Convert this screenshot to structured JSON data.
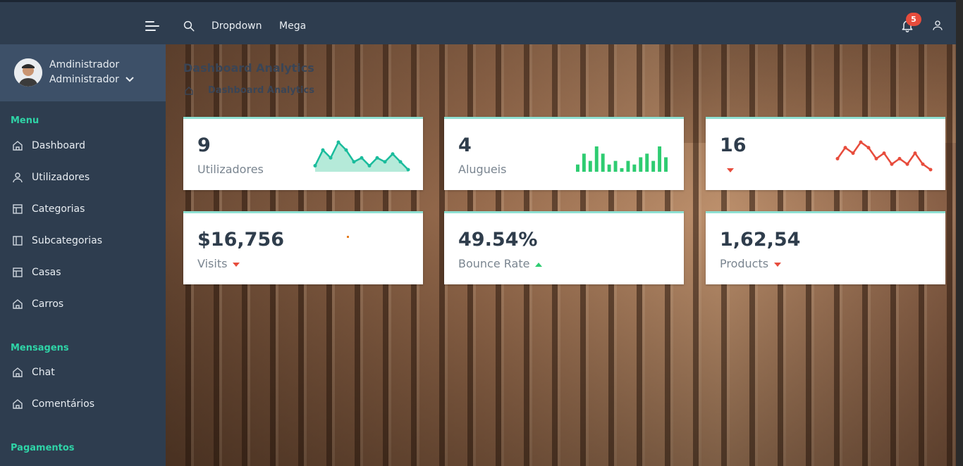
{
  "header": {
    "nav_links": [
      "Dropdown",
      "Mega"
    ],
    "notification_count": "5"
  },
  "sidebar": {
    "profile": {
      "name": "Amdinistrador",
      "role": "Administrador"
    },
    "sections": [
      {
        "title": "Menu",
        "items": [
          {
            "label": "Dashboard",
            "icon": "home-icon"
          },
          {
            "label": "Utilizadores",
            "icon": "user-icon"
          },
          {
            "label": "Categorias",
            "icon": "table-icon"
          },
          {
            "label": "Subcategorias",
            "icon": "columns-icon"
          },
          {
            "label": "Casas",
            "icon": "table-icon"
          },
          {
            "label": "Carros",
            "icon": "home-icon"
          }
        ]
      },
      {
        "title": "Mensagens",
        "items": [
          {
            "label": "Chat",
            "icon": "home-icon"
          },
          {
            "label": "Comentários",
            "icon": "home-icon"
          }
        ]
      },
      {
        "title": "Pagamentos",
        "items": []
      }
    ]
  },
  "page": {
    "title": "Dashboard Analytics",
    "breadcrumb": "Dashboard Analytics"
  },
  "cards": [
    {
      "value": "9",
      "label": "Utilizadores",
      "trend": "",
      "spark": "area",
      "color": "#1abc9c"
    },
    {
      "value": "4",
      "label": "Alugueis",
      "trend": "",
      "spark": "bar",
      "color": "#2ecc71"
    },
    {
      "value": "16",
      "label": "",
      "trend": "down",
      "spark": "line",
      "color": "#e74c3c"
    },
    {
      "value": "$16,756",
      "label": "Visits",
      "trend": "down",
      "spark": "dot",
      "color": "#e67e22"
    },
    {
      "value": "49.54%",
      "label": "Bounce Rate",
      "trend": "up",
      "spark": "none",
      "color": "#2ecc71"
    },
    {
      "value": "1,62,54",
      "label": "Products",
      "trend": "down",
      "spark": "none",
      "color": "#e74c3c"
    }
  ],
  "sparklines": {
    "area": [
      2,
      6,
      4,
      8,
      6,
      3,
      4,
      2,
      4,
      3,
      5,
      3,
      1
    ],
    "bar": [
      2,
      5,
      3,
      7,
      5,
      2,
      3,
      1,
      3,
      2,
      4,
      5,
      3,
      7,
      4
    ],
    "line": [
      4,
      6,
      5,
      7,
      6,
      4,
      5,
      3,
      4,
      3,
      5,
      3,
      2
    ]
  }
}
